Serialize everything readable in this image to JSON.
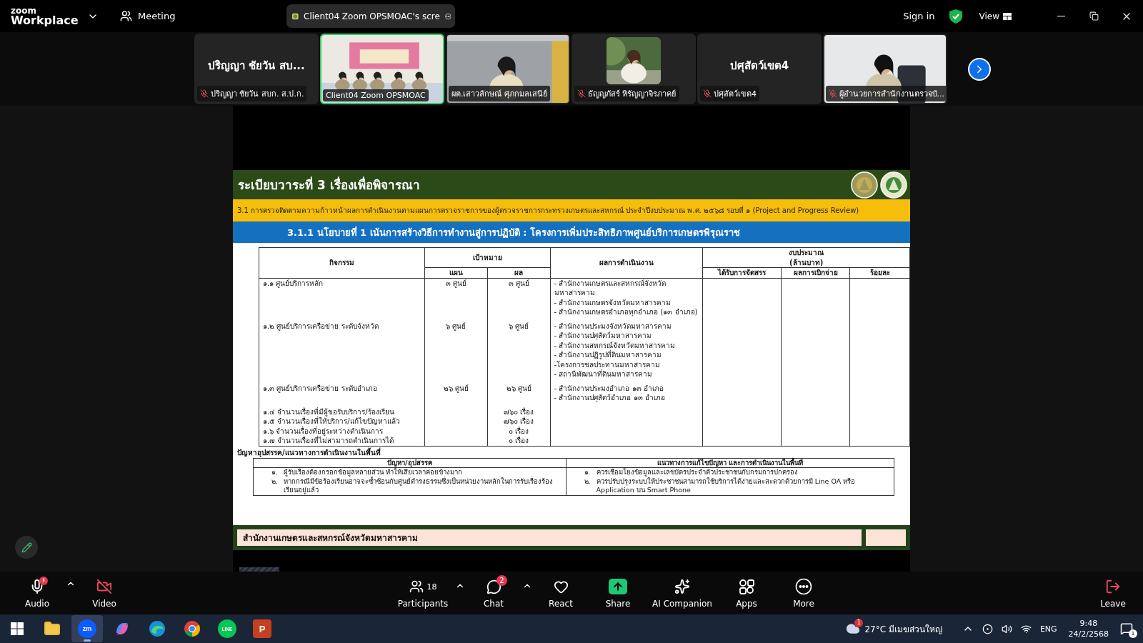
{
  "app": {
    "logo_top": "zoom",
    "logo_bottom": "Workplace",
    "meeting_label": "Meeting"
  },
  "share_pill": {
    "label": "Client04 Zoom OPSMOAC's scre"
  },
  "top_right": {
    "sign_in": "Sign in",
    "view": "View"
  },
  "tiles": [
    {
      "kind": "name",
      "display_name": "ปริญญา ชัยวัน สบ...",
      "label": "ปริญญา ชัยวัน สบก. ส.ป.ก.",
      "muted": true,
      "speaking": false
    },
    {
      "kind": "video",
      "label": "Client04 Zoom OPSMOAC",
      "muted": false,
      "speaking": true
    },
    {
      "kind": "video",
      "label": "ผต.เสาวลักษณ์ ศุภกมลเสนีย์",
      "muted": false,
      "speaking": false
    },
    {
      "kind": "avatar",
      "label": "ธัญญภัสร์ หิรัญญาจิรภาคย์",
      "muted": true,
      "speaking": false
    },
    {
      "kind": "name",
      "display_name": "ปศุสัตว์เขต4",
      "label": "ปศุสัตว์เขต4",
      "muted": true,
      "speaking": false
    },
    {
      "kind": "video",
      "label": "ผู้อำนวยการสำนักงานตรวจบั...",
      "muted": true,
      "speaking": false
    }
  ],
  "slide": {
    "title": "ระเบียบวาระที่ 3 เรื่องเพื่อพิจารณา",
    "subtitle": "3.1 การตรวจติดตามความก้าวหน้าผลการดำเนินงานตามแผนการตรวจราชการของผู้ตรวจราชการกระทรวงเกษตรและสหกรณ์ ประจำปีงบประมาณ พ.ศ. ๒๕๖๘ รอบที่ ๑ (Project and Progress Review)",
    "policy": "3.1.1 นโยบายที่ 1 เน้นการสร้างวิธีการทำงานสู่การปฏิบัติ : โครงการเพิ่มประสิทธิภาพศูนย์บริการเกษตรพิรุณราช",
    "table": {
      "headers": {
        "activity": "กิจกรรม",
        "target": "เป้าหมาย",
        "plan": "แผน",
        "result": "ผล",
        "outcome": "ผลการดำเนินงาน",
        "budget": [
          "งบประมาณ",
          "(ล้านบาท)"
        ],
        "allocated": "ได้รับการจัดสรร",
        "disbursed": "ผลการเบิกจ่าย",
        "percent": "ร้อยละ"
      },
      "rows": [
        {
          "activity": "๑.๑ ศูนย์บริการหลัก",
          "plan": "๓ ศูนย์",
          "result": "๓ ศูนย์",
          "outcomes": [
            "- สำนักงานเกษตรและสหกรณ์จังหวัดมหาสารคาม",
            "- สำนักงานเกษตรจังหวัดมหาสารคาม",
            "- สำนักงานเกษตรอำเภอทุกอำเภอ (๑๓ อำเภอ)"
          ]
        },
        {
          "activity": "๑.๒ ศูนย์บริการเครือข่าย ระดับจังหวัด",
          "plan": "๖ ศูนย์",
          "result": "๖ ศูนย์",
          "outcomes": [
            "- สำนักงานประมงจังหวัดมหาสารคาม",
            "- สำนักงานปศุสัตว์มหาสารคาม",
            "- สำนักงานสหกรณ์จังหวัดมหาสารคาม",
            "- สำนักงานปฏิรูปที่ดินมหาสารคาม",
            "-โครงการชลประทานมหาสารคาม",
            "- สถานีพัฒนาที่ดินมหาสารคาม"
          ]
        },
        {
          "activity": "๑.๓ ศูนย์บริการเครือข่าย ระดับอำเภอ",
          "plan": "๒๖ ศูนย์",
          "result": "๒๖ ศูนย์",
          "outcomes": [
            "- สำนักงานประมงอำเภอ ๑๓ อำเภอ",
            "- สำนักงานปศุสัตว์อำเภอ ๑๓ อำเภอ"
          ]
        },
        {
          "activity": "๑.๔ จำนวนเรื่องที่มีผู้ขอรับบริการ/ร้องเรียน",
          "result": "๗๖๐ เรื่อง"
        },
        {
          "activity": "๑.๕ จำนวนเรื่องที่ให้บริการ/แก้ไขปัญหาแล้ว",
          "result": "๗๖๐ เรื่อง"
        },
        {
          "activity": "๑.๖ จำนวนเรื่องที่อยู่ระหว่างดำเนินการ",
          "result": "๐ เรื่อง"
        },
        {
          "activity": "๑.๗ จำนวนเรื่องที่ไม่สามารถดำเนินการได้",
          "result": "๐ เรื่อง"
        }
      ]
    },
    "issues": {
      "label": "ปัญหาอุปสรรค/แนวทางการดำเนินงานในพื้นที่",
      "columns": [
        "ปัญหา/อุปสรรค",
        "แนวทางการแก้ไขปัญหา และการดำเนินงานในพื้นที่"
      ],
      "rows": [
        {
          "problem_number": "๑.",
          "problem": "ผู้รับเรื่องต้องกรอกข้อมูลหลายส่วน ทำให้เสียเวลาค่อยข้างมาก",
          "solution_number": "๑.",
          "solution": "ควรเชื่อมโยงข้อมูลและเลขบัตรประจำตัวประชาชนกับกรมการปกครอง"
        },
        {
          "problem_number": "๒.",
          "problem": "หากกรณีมีข้อร้องเรียนอาจจะซ้ำซ้อนกับศูนย์ดำรงธรรมซึ่งเป็นหน่วยงานหลักในการรับเรื่องร้องเรียนอยู่แล้ว",
          "solution_number": "๒.",
          "solution": "ควรปรับปรุงระบบให้ประชาชนสามารถใช้บริการได้ง่ายและสะดวกด้วยการมี Line OA หรือ Application บน Smart Phone"
        }
      ]
    },
    "footer": {
      "office": "สำนักงานเกษตรและสหกรณ์จังหวัดมหาสารคาม"
    }
  },
  "toolbar": {
    "left": [
      {
        "kind": "audio",
        "label": "Audio",
        "alert": true,
        "menu": true
      },
      {
        "kind": "video",
        "label": "Video"
      }
    ],
    "center": [
      {
        "kind": "participants",
        "label": "Participants",
        "count": "18",
        "menu": true
      },
      {
        "kind": "chat",
        "label": "Chat",
        "badge": "2",
        "menu": true
      },
      {
        "kind": "react",
        "label": "React"
      },
      {
        "kind": "share",
        "label": "Share"
      },
      {
        "kind": "ai",
        "label": "AI Companion"
      },
      {
        "kind": "apps",
        "label": "Apps"
      },
      {
        "kind": "more",
        "label": "More"
      }
    ],
    "leave": "Leave"
  },
  "taskbar": {
    "apps": [
      {
        "kind": "start",
        "active": false
      },
      {
        "kind": "explorer",
        "active": false
      },
      {
        "kind": "zoom",
        "glyph": "zm",
        "active": true
      },
      {
        "kind": "copilot",
        "active": false
      },
      {
        "kind": "edge",
        "active": false
      },
      {
        "kind": "chrome",
        "active": false
      },
      {
        "kind": "line",
        "glyph": "LINE",
        "active": false
      },
      {
        "kind": "powerpoint",
        "glyph": "P",
        "active": false
      }
    ],
    "weather": {
      "badge": "1",
      "temp": "27°C",
      "desc": "มีเมฆส่วนใหญ่"
    },
    "lang": "ENG",
    "time": "9:48",
    "date": "24/2/2568",
    "notifications": "1"
  }
}
